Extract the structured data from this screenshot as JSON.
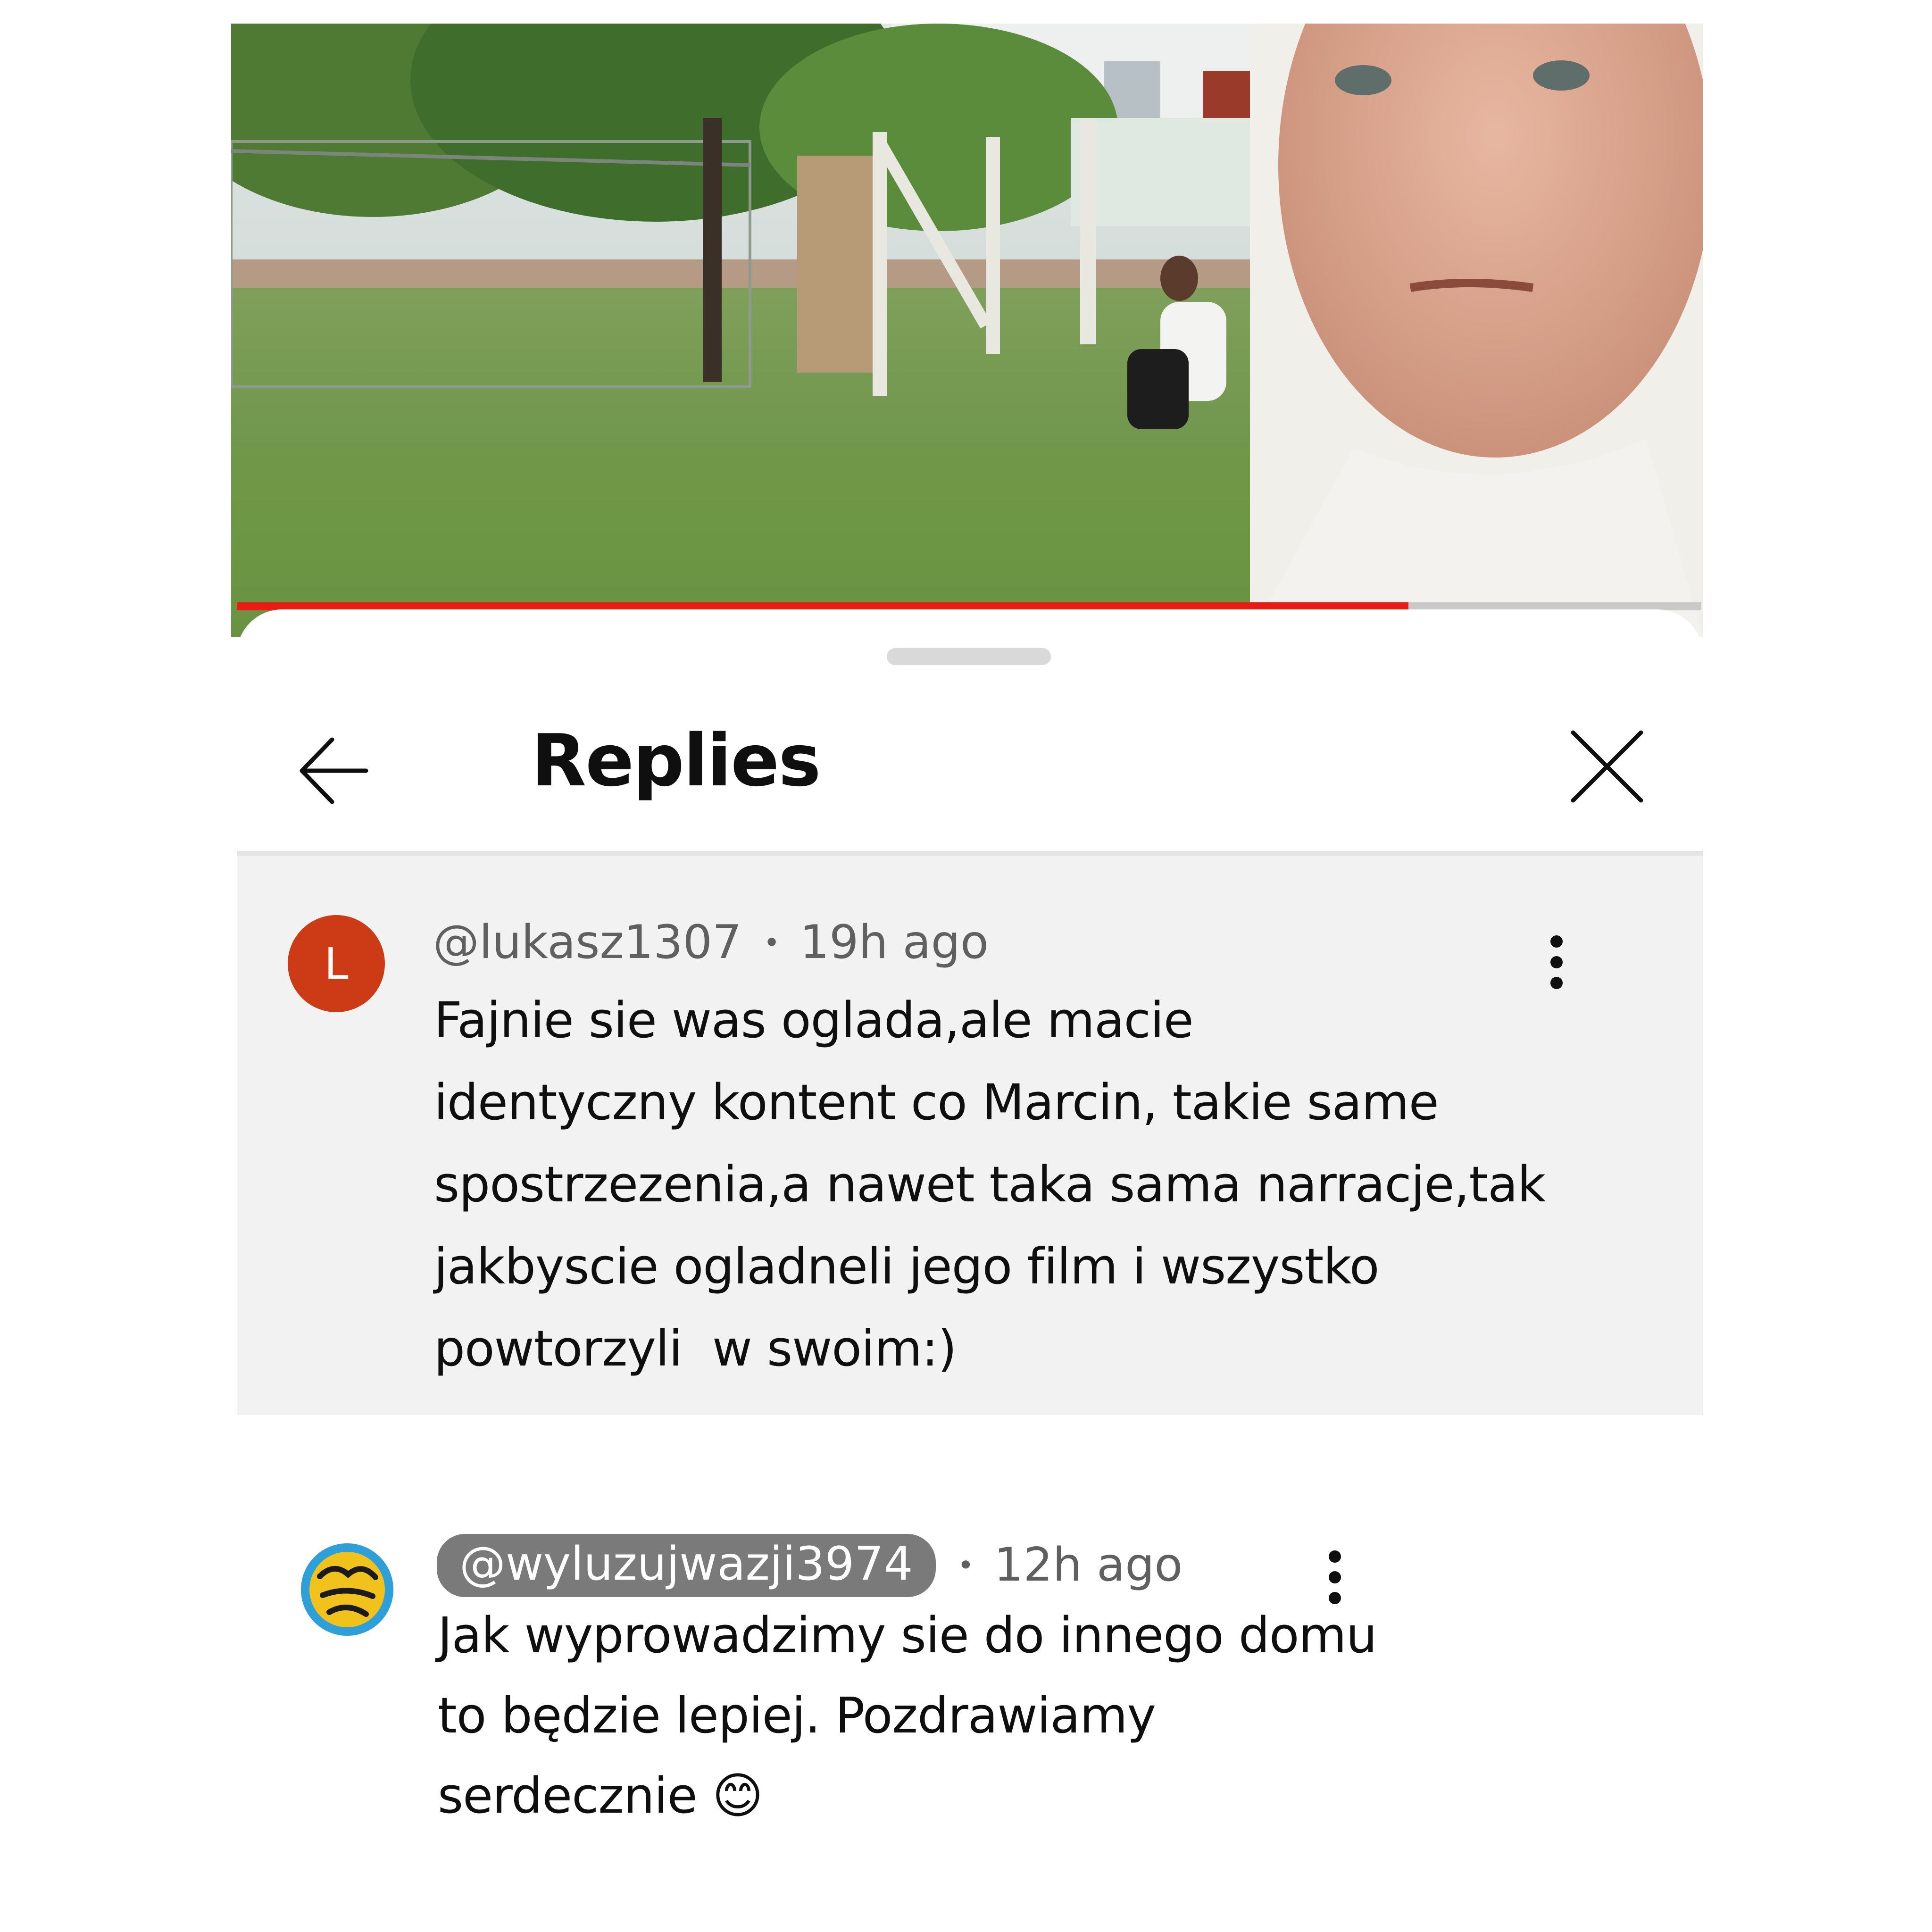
{
  "video": {
    "progress_fraction": 0.8
  },
  "sheet": {
    "title": "Replies"
  },
  "parent_comment": {
    "avatar_letter": "L",
    "avatar_color": "#cc3b15",
    "author": "@lukasz1307",
    "separator": "•",
    "time": "19h ago",
    "text_lines": [
      "Fajnie sie was oglada,ale macie",
      "identyczny kontent co Marcin, takie same",
      "spostrzezenia,a nawet taka sama narracje,tak",
      "jakbyscie ogladneli jego film i wszystko",
      "powtorzyli  w swoim:)"
    ]
  },
  "reply": {
    "avatar_icon": "wyluzuj-w-azji-logo",
    "author": "@wyluzujwazji3974",
    "separator": "•",
    "time": "12h ago",
    "text_lines": [
      "Jak wyprowadzimy sie do innego domu",
      "to będzie lepiej. Pozdrawiamy",
      "serdecznie 😊"
    ]
  },
  "colors": {
    "progress": "#e91b14",
    "highlight_bg": "#f2f2f2",
    "creator_badge": "#7a7a7a"
  }
}
